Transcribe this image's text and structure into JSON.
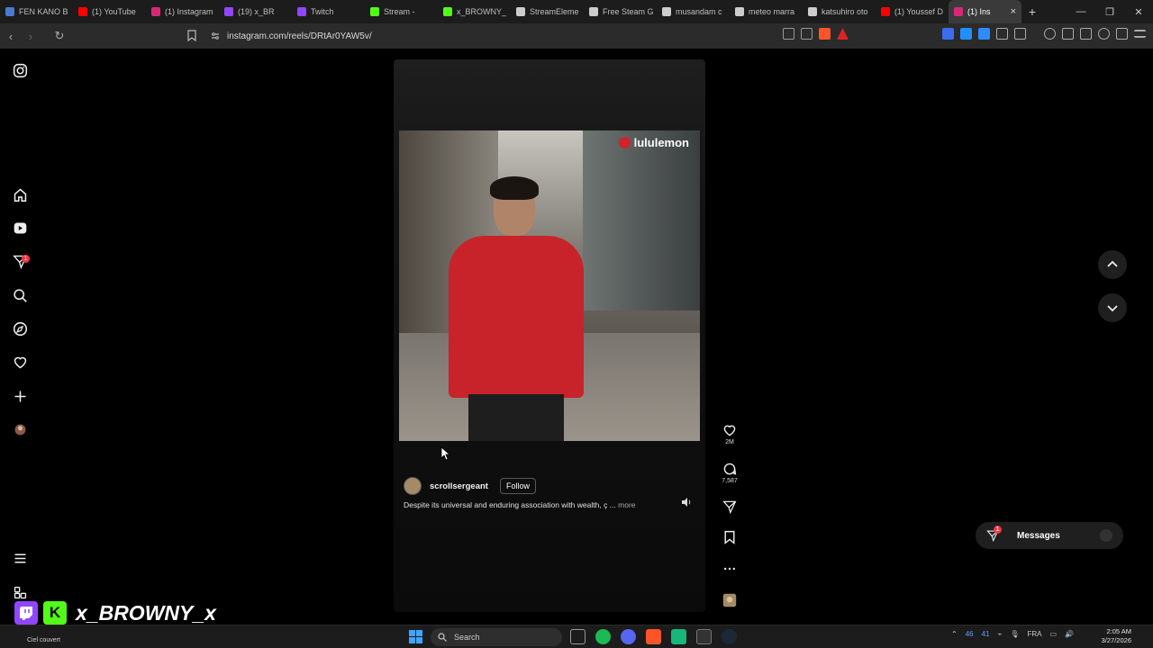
{
  "browser": {
    "tabs": [
      {
        "label": "FEN KANO B",
        "color": "#4a7bd0"
      },
      {
        "label": "(1) YouTube",
        "color": "#ff0000"
      },
      {
        "label": "(1) Instagram",
        "color": "#d62976"
      },
      {
        "label": "(19) x_BR",
        "color": "#9146ff"
      },
      {
        "label": "Twitch",
        "color": "#9146ff"
      },
      {
        "label": "Stream -",
        "color": "#53fc18"
      },
      {
        "label": "x_BROWNY_",
        "color": "#53fc18"
      },
      {
        "label": "StreamEleme",
        "color": "#cccccc"
      },
      {
        "label": "Free Steam G",
        "color": "#cccccc"
      },
      {
        "label": "musandam c",
        "color": "#cccccc"
      },
      {
        "label": "meteo marra",
        "color": "#cccccc"
      },
      {
        "label": "katsuhiro oto",
        "color": "#cccccc"
      },
      {
        "label": "(1) Youssef D",
        "color": "#ff0000"
      },
      {
        "label": "(1) Ins",
        "color": "#d62976",
        "active": true
      }
    ],
    "new_tab": "+",
    "window_controls": [
      "—",
      "❐",
      "✕"
    ],
    "url": "instagram.com/reels/DRtAr0YAW5v/"
  },
  "reel": {
    "brand_overlay": "lululemon",
    "author": "scrollsergeant",
    "follow_label": "Follow",
    "caption": "Despite its universal and enduring association with wealth, ç",
    "more_label": "more",
    "likes": "2M",
    "comments": "7,587"
  },
  "nav": {
    "notifications_badge": "1"
  },
  "messages": {
    "label": "Messages",
    "badge": "1"
  },
  "overlay": {
    "streamer_name": "x_BROWNY_x",
    "kick_letter": "K"
  },
  "taskbar": {
    "weather": "Ciel couvert",
    "search_label": "Search",
    "tray_numbers": [
      "46",
      "41"
    ],
    "language": "FRA",
    "time": "2:05 AM",
    "date": "3/27/2026"
  }
}
